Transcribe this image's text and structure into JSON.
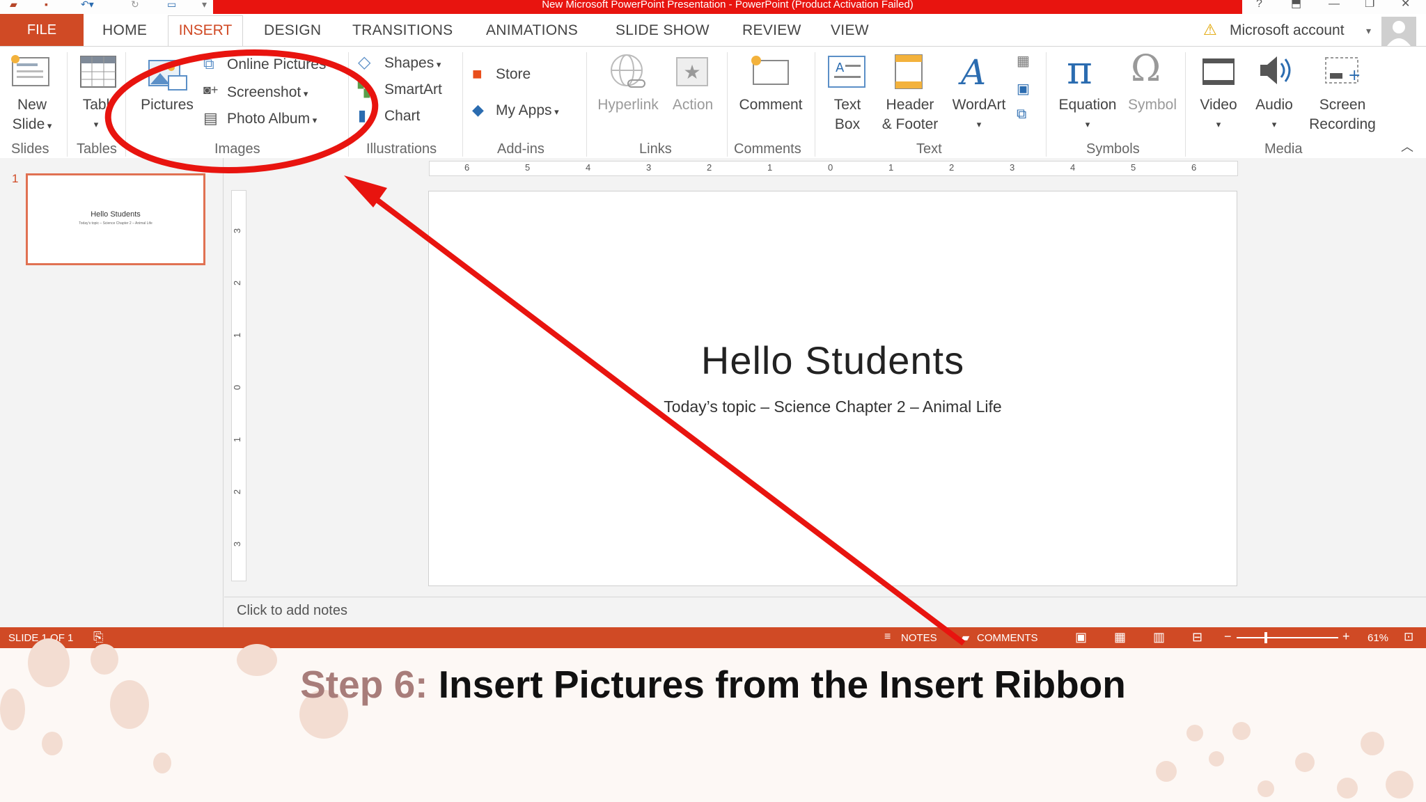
{
  "window": {
    "title": "New Microsoft PowerPoint Presentation -  PowerPoint (Product Activation Failed)",
    "account": "Microsoft account"
  },
  "tabs": [
    "FILE",
    "HOME",
    "INSERT",
    "DESIGN",
    "TRANSITIONS",
    "ANIMATIONS",
    "SLIDE SHOW",
    "REVIEW",
    "VIEW"
  ],
  "ribbon": {
    "slides": {
      "new_slide_line1": "New",
      "new_slide_line2": "Slide",
      "group": "Slides"
    },
    "tables": {
      "table": "Tabl",
      "group": "Tables"
    },
    "images": {
      "pictures": "Pictures",
      "online_pictures": "Online Pictures",
      "screenshot": "Screenshot",
      "photo_album": "Photo Album",
      "group": "Images"
    },
    "illustrations": {
      "shapes": "Shapes",
      "smartart": "SmartArt",
      "chart": "Chart",
      "group": "Illustrations"
    },
    "addins": {
      "store": "Store",
      "my_apps": "My Apps",
      "group": "Add-ins"
    },
    "links": {
      "hyperlink": "Hyperlink",
      "action": "Action",
      "group": "Links"
    },
    "comments": {
      "comment": "Comment",
      "group": "Comments"
    },
    "text": {
      "text_box_1": "Text",
      "text_box_2": "Box",
      "header_1": "Header",
      "header_2": "& Footer",
      "wordart": "WordArt",
      "group": "Text"
    },
    "symbols": {
      "equation": "Equation",
      "symbol": "Symbol",
      "group": "Symbols"
    },
    "media": {
      "video": "Video",
      "audio": "Audio",
      "screen_rec_1": "Screen",
      "screen_rec_2": "Recording",
      "group": "Media"
    }
  },
  "ruler": {
    "h_ticks": [
      "6",
      "5",
      "4",
      "3",
      "2",
      "1",
      "0",
      "1",
      "2",
      "3",
      "4",
      "5",
      "6"
    ],
    "v_ticks": [
      "3",
      "2",
      "1",
      "0",
      "1",
      "2",
      "3"
    ]
  },
  "thumbnail": {
    "number": "1",
    "title": "Hello Students",
    "subtitle": "Today's topic – Science Chapter 2 – Animal Life"
  },
  "slide": {
    "title": "Hello Students",
    "subtitle": "Today’s topic – Science Chapter 2 – Animal Life"
  },
  "notes_placeholder": "Click to add notes",
  "statusbar": {
    "slide_counter": "SLIDE 1 OF 1",
    "notes": "NOTES",
    "comments": "COMMENTS",
    "zoom": "61%"
  },
  "caption": {
    "step": "Step 6:",
    "text": " Insert Pictures from the Insert Ribbon"
  },
  "colors": {
    "accent": "#d04a25",
    "annotation": "#e8140f",
    "step_label": "#a87d7a"
  }
}
